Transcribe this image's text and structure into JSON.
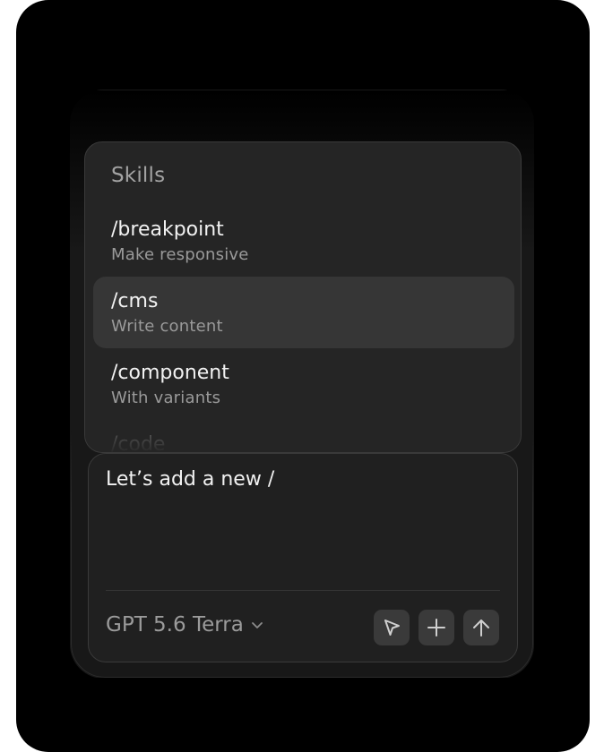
{
  "skills_menu": {
    "title": "Skills",
    "items": [
      {
        "command": "/breakpoint",
        "description": "Make responsive"
      },
      {
        "command": "/cms",
        "description": "Write content"
      },
      {
        "command": "/component",
        "description": "With variants"
      },
      {
        "command": "/code",
        "description": ""
      }
    ],
    "highlighted_index": 1
  },
  "composer": {
    "text": "Let’s add a new /",
    "model": "GPT 5.6 Terra",
    "buttons": {
      "cursor_icon": "cursor-arrow-icon",
      "add_icon": "plus-icon",
      "send_icon": "arrow-up-icon"
    }
  },
  "colors": {
    "background": "#000000",
    "popup": "#252525",
    "highlight": "#363636",
    "button": "#3a3a3a"
  }
}
